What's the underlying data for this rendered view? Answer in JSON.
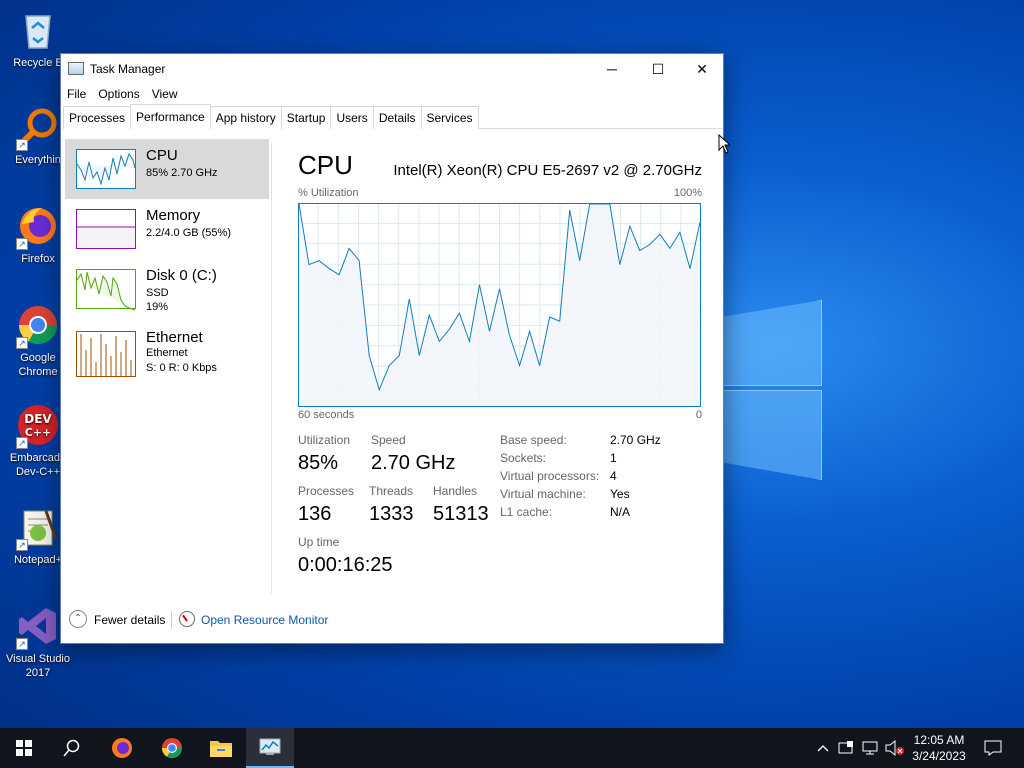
{
  "desktop": {
    "icons": [
      {
        "label": "Recycle B",
        "icon": "recycle-bin-icon"
      },
      {
        "label": "Everythin",
        "icon": "everything-search-icon"
      },
      {
        "label": "Firefox",
        "icon": "firefox-icon"
      },
      {
        "label": "Google\nChrome",
        "icon": "chrome-icon"
      },
      {
        "label": "Embarcade\nDev-C++",
        "icon": "devcpp-icon"
      },
      {
        "label": "Notepad+",
        "icon": "notepadpp-icon"
      },
      {
        "label": "Visual Studio\n2017",
        "icon": "visual-studio-icon"
      }
    ]
  },
  "window": {
    "title": "Task Manager",
    "controls": {
      "minimize": "─",
      "maximize": "☐",
      "close": "✕"
    },
    "menu": [
      "File",
      "Options",
      "View"
    ],
    "tabs": [
      "Processes",
      "Performance",
      "App history",
      "Startup",
      "Users",
      "Details",
      "Services"
    ],
    "active_tab": "Performance",
    "sidebar": {
      "cpu": {
        "name": "CPU",
        "line1": "85% 2.70 GHz",
        "color": "#117dbb"
      },
      "memory": {
        "name": "Memory",
        "line1": "2.2/4.0 GB (55%)",
        "color": "#8b12ae"
      },
      "disk": {
        "name": "Disk 0 (C:)",
        "line1": "SSD",
        "line2": "19%",
        "color": "#4da60c"
      },
      "ethernet": {
        "name": "Ethernet",
        "line1": "Ethernet",
        "line2": "S: 0  R: 0 Kbps",
        "color": "#a74f01"
      }
    },
    "cpu_panel": {
      "title": "CPU",
      "model": "Intel(R) Xeon(R) CPU E5-2697 v2 @ 2.70GHz",
      "y_label": "% Utilization",
      "y_max_label": "100%",
      "x_left_label": "60 seconds",
      "x_right_label": "0",
      "stats": {
        "utilization_label": "Utilization",
        "utilization": "85%",
        "speed_label": "Speed",
        "speed": "2.70 GHz",
        "processes_label": "Processes",
        "processes": "136",
        "threads_label": "Threads",
        "threads": "1333",
        "handles_label": "Handles",
        "handles": "51313",
        "uptime_label": "Up time",
        "uptime": "0:00:16:25"
      },
      "details": [
        {
          "k": "Base speed:",
          "v": "2.70 GHz"
        },
        {
          "k": "Sockets:",
          "v": "1"
        },
        {
          "k": "Virtual processors:",
          "v": "4"
        },
        {
          "k": "Virtual machine:",
          "v": "Yes"
        },
        {
          "k": "L1 cache:",
          "v": "N/A"
        }
      ]
    },
    "footer": {
      "fewer_details": "Fewer details",
      "resource_monitor": "Open Resource Monitor"
    }
  },
  "chart_data": {
    "type": "area",
    "x_range": [
      60,
      0
    ],
    "ylim": [
      0,
      100
    ],
    "grid": true,
    "color": "#117dbb",
    "fill": "#f1f6fa",
    "values": [
      100,
      70,
      72,
      68,
      65,
      78,
      72,
      25,
      8,
      20,
      25,
      53,
      25,
      45,
      32,
      38,
      46,
      32,
      60,
      37,
      58,
      35,
      20,
      37,
      20,
      44,
      42,
      97,
      72,
      100,
      101,
      100,
      70,
      89,
      77,
      80,
      85,
      78,
      86,
      68,
      91
    ]
  },
  "taskbar": {
    "buttons": [
      "start-icon",
      "search-icon",
      "firefox-icon",
      "chrome-icon",
      "file-explorer-icon",
      "task-manager-icon"
    ],
    "clock_time": "12:05 AM",
    "clock_date": "3/24/2023"
  }
}
